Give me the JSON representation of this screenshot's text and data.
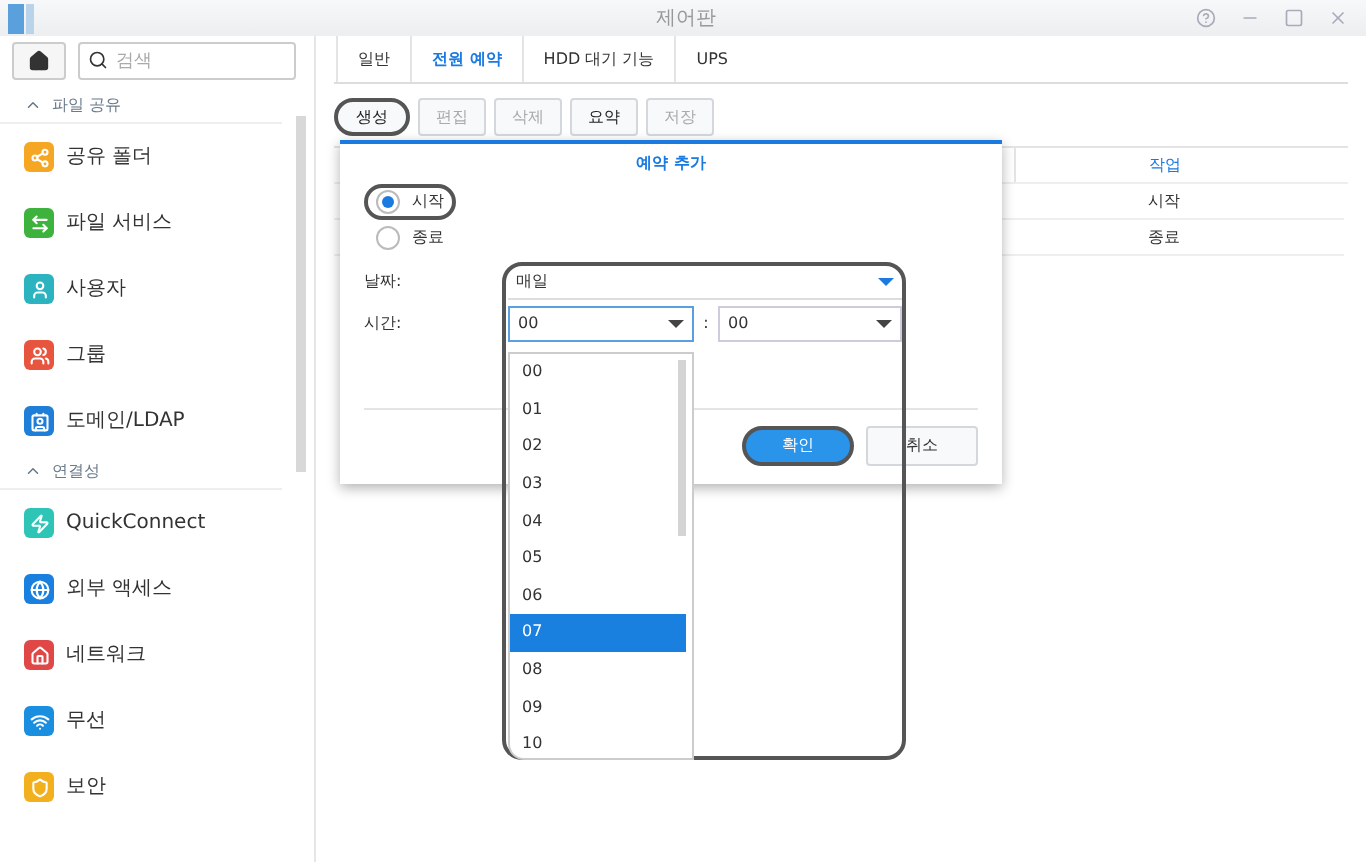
{
  "window": {
    "title": "제어판"
  },
  "search": {
    "placeholder": "검색"
  },
  "sidebar": {
    "sections": [
      {
        "title": "파일 공유",
        "expanded": true,
        "items": [
          {
            "label": "공유 폴더",
            "kind": "shared-folder"
          },
          {
            "label": "파일 서비스",
            "kind": "file-services"
          },
          {
            "label": "사용자",
            "kind": "user"
          },
          {
            "label": "그룹",
            "kind": "group"
          },
          {
            "label": "도메인/LDAP",
            "kind": "domain"
          }
        ]
      },
      {
        "title": "연결성",
        "expanded": true,
        "items": [
          {
            "label": "QuickConnect",
            "kind": "quickconnect"
          },
          {
            "label": "외부 액세스",
            "kind": "external-access"
          },
          {
            "label": "네트워크",
            "kind": "network"
          },
          {
            "label": "무선",
            "kind": "wireless"
          },
          {
            "label": "보안",
            "kind": "security"
          }
        ]
      }
    ]
  },
  "tabs": [
    {
      "label": "일반",
      "selected": false
    },
    {
      "label": "전원 예약",
      "selected": true
    },
    {
      "label": "HDD 대기 기능",
      "selected": false
    },
    {
      "label": "UPS",
      "selected": false
    }
  ],
  "toolbar": [
    {
      "label": "생성",
      "disabled": false,
      "highlighted": true
    },
    {
      "label": "편집",
      "disabled": true,
      "highlighted": false
    },
    {
      "label": "삭제",
      "disabled": true,
      "highlighted": false
    },
    {
      "label": "요약",
      "disabled": false,
      "highlighted": false
    },
    {
      "label": "저장",
      "disabled": true,
      "highlighted": false
    }
  ],
  "table": {
    "columns": [
      "작업"
    ],
    "rows": [
      [
        "시작"
      ],
      [
        "종료"
      ]
    ]
  },
  "dialog": {
    "title": "예약 추가",
    "radios": [
      {
        "label": "시작",
        "selected": true,
        "highlighted": true
      },
      {
        "label": "종료",
        "selected": false,
        "highlighted": false
      }
    ],
    "date_label": "날짜:",
    "date_value": "매일",
    "time_label": "시간:",
    "hour": "00",
    "separator": ":",
    "minute": "00",
    "schedule_highlighted": true,
    "buttons": [
      {
        "label": "확인",
        "kind": "primary",
        "highlighted": true
      },
      {
        "label": "취소",
        "kind": "secondary",
        "highlighted": false
      }
    ]
  },
  "hour_options": [
    {
      "label": "00",
      "selected": false
    },
    {
      "label": "01",
      "selected": false
    },
    {
      "label": "02",
      "selected": false
    },
    {
      "label": "03",
      "selected": false
    },
    {
      "label": "04",
      "selected": false
    },
    {
      "label": "05",
      "selected": false
    },
    {
      "label": "06",
      "selected": false
    },
    {
      "label": "07",
      "selected": true
    },
    {
      "label": "08",
      "selected": false
    },
    {
      "label": "09",
      "selected": false
    },
    {
      "label": "10",
      "selected": false
    }
  ]
}
